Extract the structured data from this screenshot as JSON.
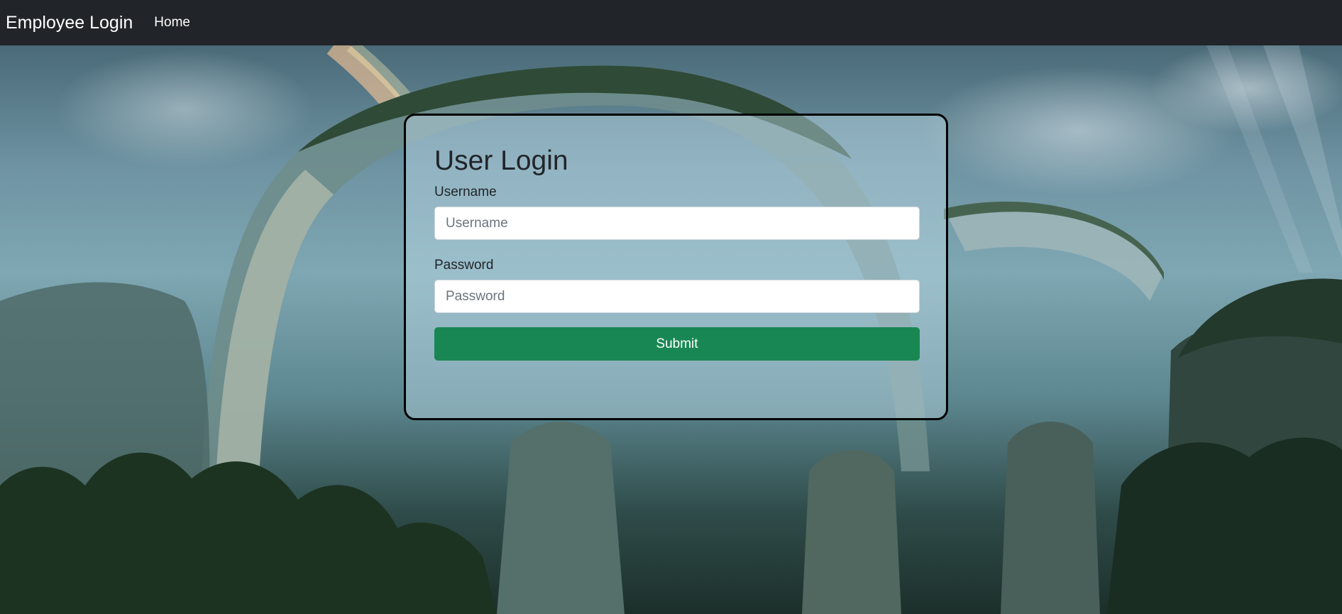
{
  "navbar": {
    "brand": "Employee Login",
    "links": [
      {
        "label": "Home"
      }
    ]
  },
  "login_form": {
    "title": "User Login",
    "username": {
      "label": "Username",
      "placeholder": "Username",
      "value": ""
    },
    "password": {
      "label": "Password",
      "placeholder": "Password",
      "value": ""
    },
    "submit_label": "Submit"
  },
  "colors": {
    "navbar_bg": "#212529",
    "submit_bg": "#198754",
    "card_border": "#000000"
  }
}
